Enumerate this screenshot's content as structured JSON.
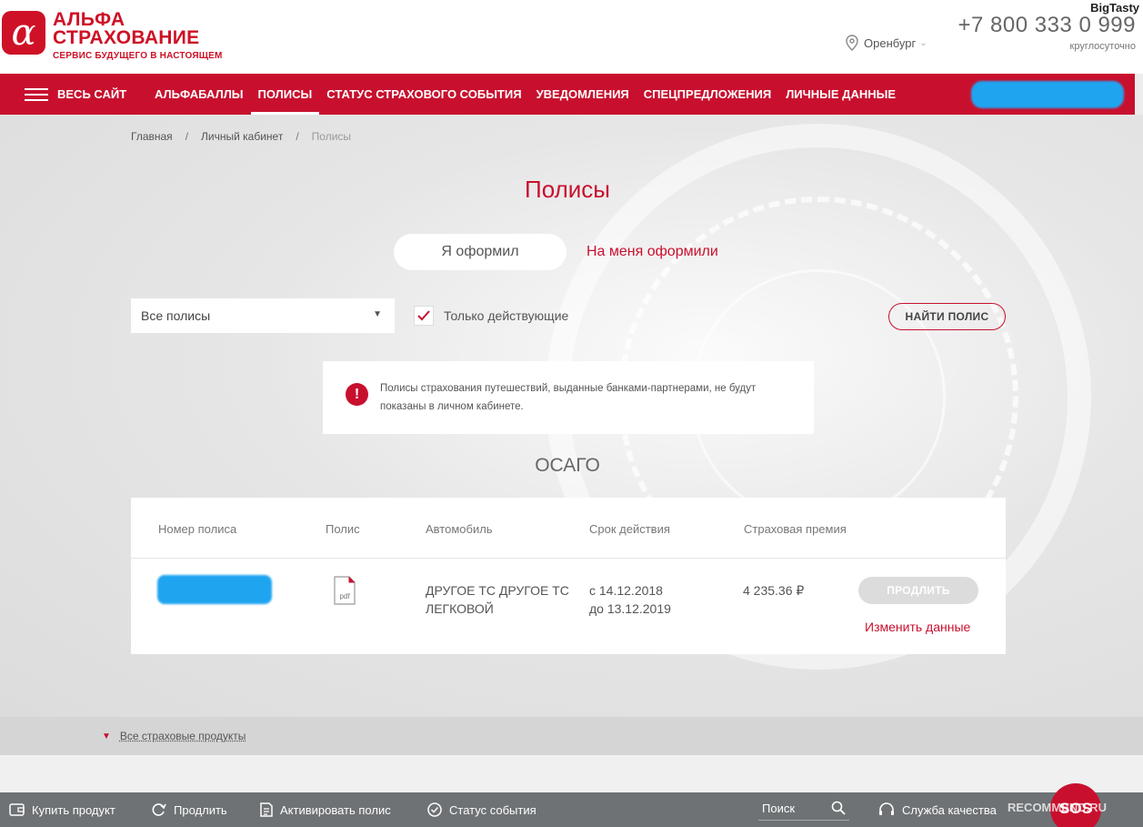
{
  "header": {
    "logo_mark": "α",
    "logo_line1": "АЛЬФА",
    "logo_line2": "СТРАХОВАНИЕ",
    "logo_tagline": "СЕРВИС БУДУЩЕГО В НАСТОЯЩЕМ",
    "city": "Оренбург",
    "phone": "+7 800 333 0 999",
    "phone_note": "круглосуточно",
    "watermark": "BigTasty"
  },
  "nav": {
    "all_site": "ВЕСЬ САЙТ",
    "items": [
      {
        "label": "АЛЬФАБАЛЛЫ",
        "active": false
      },
      {
        "label": "ПОЛИСЫ",
        "active": true
      },
      {
        "label": "СТАТУС СТРАХОВОГО СОБЫТИЯ",
        "active": false
      },
      {
        "label": "УВЕДОМЛЕНИЯ",
        "active": false
      },
      {
        "label": "СПЕЦПРЕДЛОЖЕНИЯ",
        "active": false
      },
      {
        "label": "ЛИЧНЫЕ ДАННЫЕ",
        "active": false
      }
    ]
  },
  "breadcrumb": [
    "Главная",
    "Личный кабинет",
    "Полисы"
  ],
  "page_title": "Полисы",
  "tabs": {
    "mine": "Я оформил",
    "for_me": "На меня оформили"
  },
  "filters": {
    "select_value": "Все полисы",
    "only_active_label": "Только действующие",
    "only_active_checked": true,
    "find_button": "НАЙТИ ПОЛИС"
  },
  "notice": {
    "icon": "!",
    "text": "Полисы страхования путешествий, выданные банками-партнерами, не будут показаны в личном кабинете."
  },
  "section": {
    "title": "ОСАГО",
    "columns": [
      "Номер полиса",
      "Полис",
      "Автомобиль",
      "Срок действия",
      "Страховая премия"
    ],
    "rows": [
      {
        "pdf_label": "pdf",
        "car_line1": "ДРУГОЕ ТС ДРУГОЕ ТС",
        "car_line2": "ЛЕГКОВОЙ",
        "valid_from": "с 14.12.2018",
        "valid_to": "до 13.12.2019",
        "premium": "4 235.36 ₽",
        "renew_button": "ПРОДЛИТЬ",
        "change_link": "Изменить данные"
      }
    ]
  },
  "all_products": "Все страховые продукты",
  "bottom_bar": {
    "buy": "Купить продукт",
    "renew": "Продлить",
    "activate": "Активировать полис",
    "status": "Статус события",
    "search_placeholder": "Поиск",
    "quality": "Служба качества",
    "sos": "SOS",
    "watermark": "RECOMMEND.RU"
  },
  "colors": {
    "brand_red": "#c8102e",
    "redaction_blue": "#1fa4f0"
  }
}
